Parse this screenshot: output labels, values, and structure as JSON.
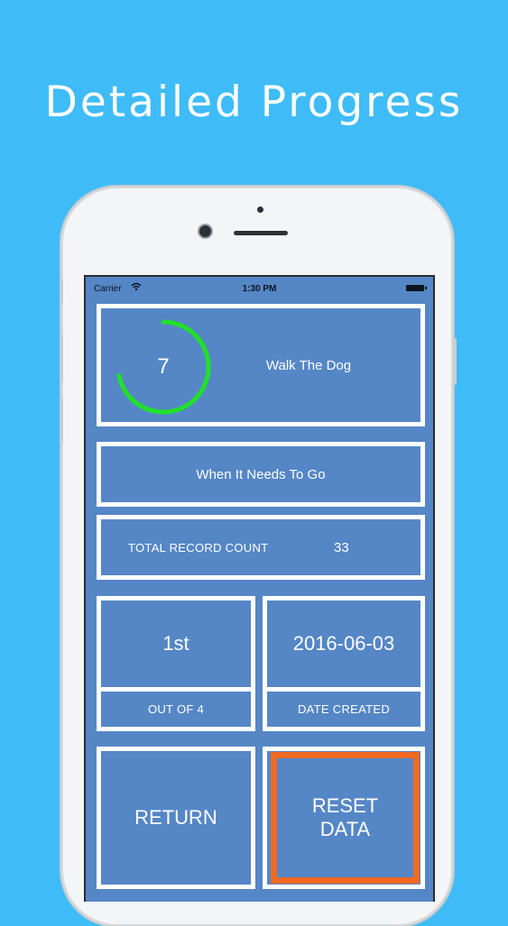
{
  "headline": "Detailed Progress",
  "status_bar": {
    "carrier": "Carrier",
    "time": "1:30 PM"
  },
  "task": {
    "count": "7",
    "name": "Walk The Dog",
    "progress_fraction": 0.72,
    "ring_color": "#21e02a"
  },
  "description": "When It Needs To Go",
  "record_count": {
    "label": "TOTAL RECORD COUNT",
    "value": "33"
  },
  "rank": {
    "value": "1st",
    "label": "OUT OF 4"
  },
  "created": {
    "value": "2016-06-03",
    "label": "DATE CREATED"
  },
  "actions": {
    "return_label": "RETURN",
    "reset_line1": "RESET",
    "reset_line2": "DATA"
  },
  "colors": {
    "background": "#3fbcf7",
    "screen": "#5586c6",
    "accent": "#f06a22"
  }
}
